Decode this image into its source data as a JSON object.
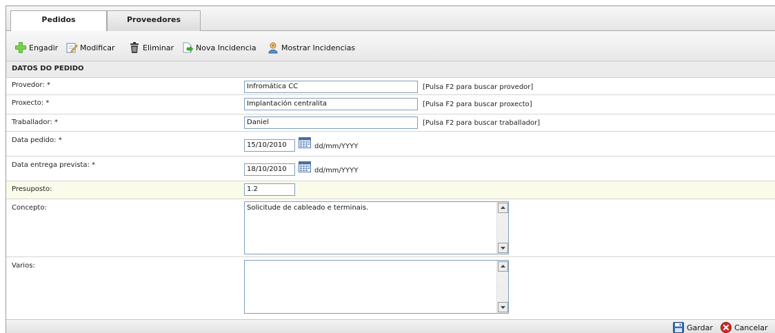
{
  "tabs": [
    {
      "label": "Pedidos",
      "active": true
    },
    {
      "label": "Proveedores",
      "active": false
    }
  ],
  "toolbar": {
    "add_label": "Engadir",
    "edit_label": "Modificar",
    "delete_label": "Eliminar",
    "new_incident_label": "Nova Incidencia",
    "show_incidents_label": "Mostrar Incidencias"
  },
  "section_title": "DATOS DO PEDIDO",
  "form": {
    "provider": {
      "label": "Provedor: *",
      "value": "Infromática CC",
      "hint": "[Pulsa F2 para buscar provedor]"
    },
    "project": {
      "label": "Proxecto: *",
      "value": "Implantación centralita",
      "hint": "[Pulsa F2 para buscar proxecto]"
    },
    "worker": {
      "label": "Traballador: *",
      "value": "Daniel",
      "hint": "[Pulsa F2 para buscar traballador]"
    },
    "order_date": {
      "label": "Data pedido: *",
      "value": "15/10/2010",
      "format": "dd/mm/YYYY"
    },
    "delivery_date": {
      "label": "Data entrega prevista: *",
      "value": "18/10/2010",
      "format": "dd/mm/YYYY"
    },
    "budget": {
      "label": "Presuposto:",
      "value": "1.2"
    },
    "concept": {
      "label": "Concepto:",
      "value": "Solicitude de cableado e terminais."
    },
    "misc": {
      "label": "Varios:",
      "value": ""
    }
  },
  "footer": {
    "save_label": "Gardar",
    "cancel_label": "Cancelar"
  },
  "colors": {
    "highlight_row": "#fbfbea",
    "input_border": "#7f9db9",
    "cancel_red": "#d2261c",
    "save_blue": "#3a6fb5"
  },
  "icons": [
    "add-icon",
    "edit-icon",
    "delete-icon",
    "new-incident-icon",
    "show-incidents-icon",
    "calendar-icon",
    "save-icon",
    "cancel-icon"
  ]
}
